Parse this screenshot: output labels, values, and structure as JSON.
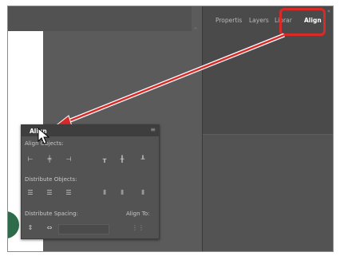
{
  "right_panel": {
    "tabs": [
      {
        "label": "Propertis"
      },
      {
        "label": "Layers"
      },
      {
        "label": "Librar"
      },
      {
        "label": "Align"
      }
    ]
  },
  "align_panel": {
    "title": "Align",
    "align_objects_label": "Align Objects:",
    "distribute_objects_label": "Distribute Objects:",
    "distribute_spacing_label": "Distribute Spacing:",
    "align_to_label": "Align To:"
  },
  "colors": {
    "highlight": "#d92a2a",
    "arrow": "#d92a2a"
  }
}
